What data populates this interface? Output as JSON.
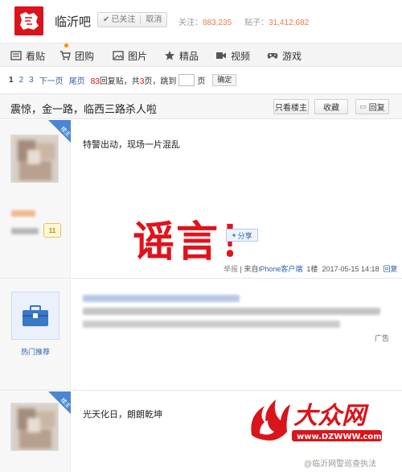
{
  "header": {
    "forum_name": "临沂吧",
    "follow_label": "已关注",
    "cancel_label": "取消",
    "followers_label": "关注：",
    "followers_count": "883,235",
    "posts_label": "贴子：",
    "posts_count": "31,412,682"
  },
  "nav": {
    "items": [
      {
        "label": "看贴",
        "icon": "list-icon"
      },
      {
        "label": "团购",
        "icon": "cart-icon"
      },
      {
        "label": "图片",
        "icon": "image-icon"
      },
      {
        "label": "精品",
        "icon": "star-icon"
      },
      {
        "label": "视频",
        "icon": "video-icon"
      },
      {
        "label": "游戏",
        "icon": "gamepad-icon"
      }
    ]
  },
  "pager": {
    "current": "1",
    "page2": "2",
    "page3": "3",
    "next": "下一页",
    "last": "尾页",
    "reply_count": "83",
    "reply_suffix": "回复贴，共",
    "page_total": "3",
    "page_suffix": "页，跳到",
    "page_unit": "页",
    "confirm": "确定"
  },
  "thread": {
    "title": "震惊，金一路，临西三路杀人啦",
    "only_op": "只看楼主",
    "favorite": "收藏",
    "reply": "回复"
  },
  "posts": [
    {
      "badge": "楼主",
      "level": "11",
      "text": "特警出动，现场一片混乱",
      "stamp": "谣言！",
      "share": "分享",
      "report": "举报",
      "from_prefix": "来自",
      "client": "iPhone客户端",
      "floor": "1楼",
      "time": "2017-05-15 14:18",
      "reply": "回复"
    },
    {
      "promo_label": "热门推荐",
      "ad": "广告"
    },
    {
      "badge": "楼主",
      "text": "光天化日，朗朗乾坤"
    }
  ],
  "watermark": {
    "logo_text": "大众网",
    "logo_url": "www.DZWWW.com",
    "footer": "@临沂网警巡查执法"
  },
  "colors": {
    "brand_red": "#d9141b",
    "link_blue": "#2d64b3",
    "stat_orange": "#e87a4a"
  }
}
